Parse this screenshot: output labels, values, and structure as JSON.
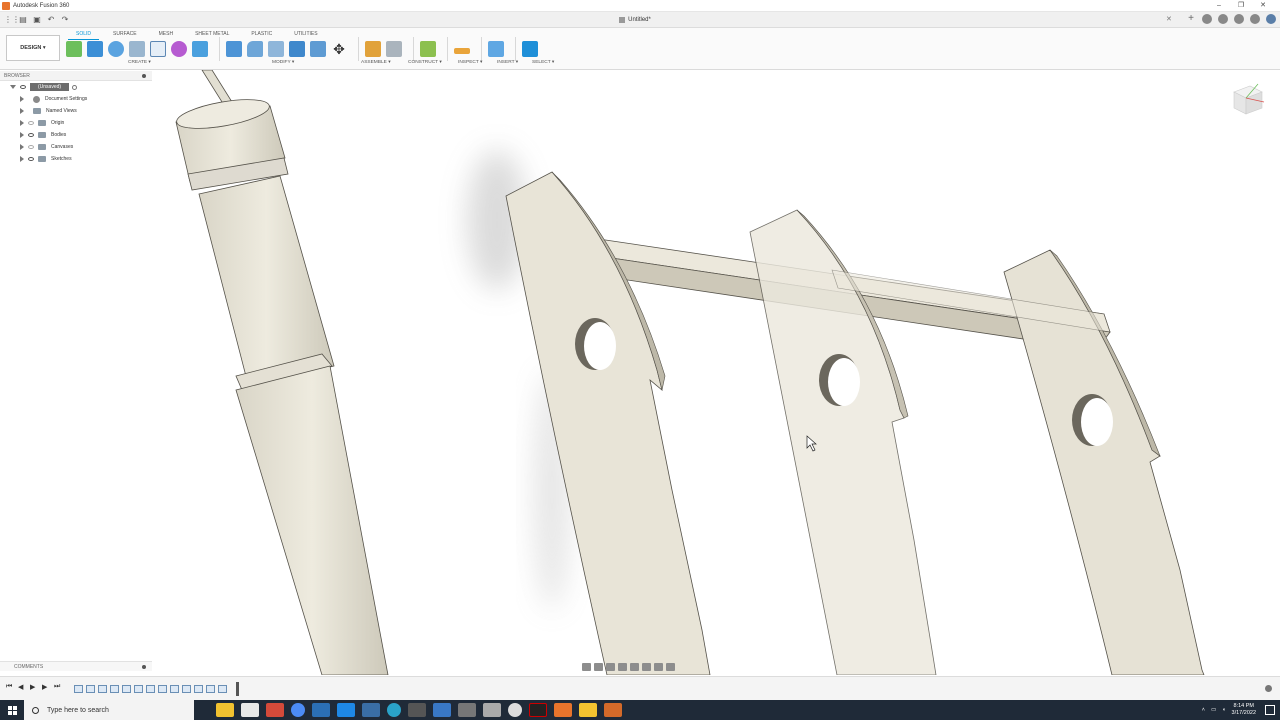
{
  "window": {
    "app_title": "Autodesk Fusion 360",
    "document_tab": "Untitled*"
  },
  "ribbon": {
    "workspace": "DESIGN ▾",
    "tabs": [
      "SOLID",
      "SURFACE",
      "MESH",
      "SHEET METAL",
      "PLASTIC",
      "UTILITIES"
    ],
    "active_tab": "SOLID",
    "groups": {
      "create": "CREATE ▾",
      "modify": "MODIFY ▾",
      "assemble": "ASSEMBLE ▾",
      "construct": "CONSTRUCT ▾",
      "inspect": "INSPECT ▾",
      "insert": "INSERT ▾",
      "select": "SELECT ▾"
    }
  },
  "browser": {
    "title": "BROWSER",
    "root": "(Unsaved)",
    "items": [
      "Document Settings",
      "Named Views",
      "Origin",
      "Bodies",
      "Canvases",
      "Sketches"
    ]
  },
  "comments": {
    "title": "COMMENTS"
  },
  "taskbar": {
    "search_placeholder": "Type here to search",
    "time": "8:14 PM",
    "date": "3/17/2022"
  },
  "colors": {
    "accent": "#0696d7",
    "body_fill": "#e7e3d6",
    "body_edge": "#55524a",
    "taskbar": "#1f2a38"
  }
}
